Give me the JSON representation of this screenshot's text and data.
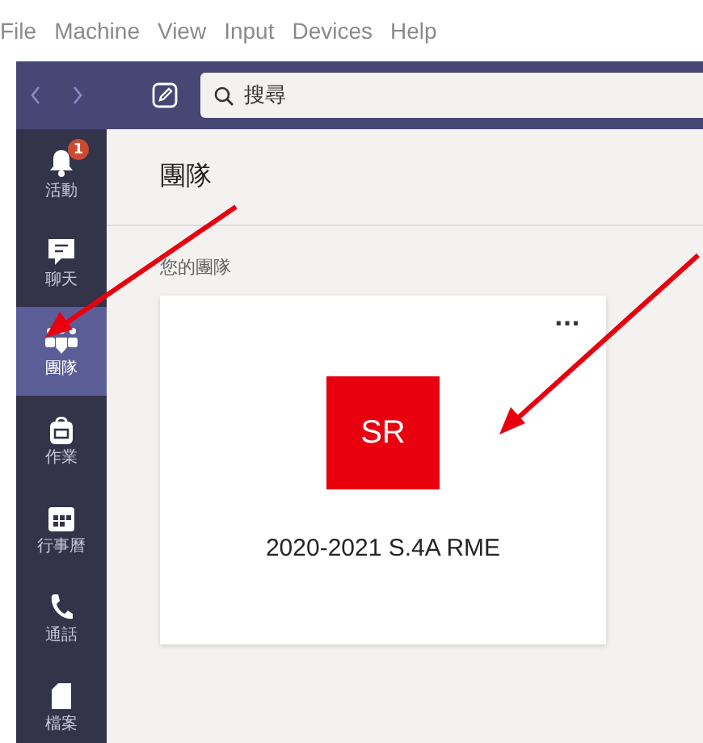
{
  "menu_bar": [
    "File",
    "Machine",
    "View",
    "Input",
    "Devices",
    "Help"
  ],
  "search": {
    "placeholder": "搜尋"
  },
  "sidebar": {
    "items": [
      {
        "kind": "bell",
        "label": "活動",
        "badge": "1",
        "selected": false
      },
      {
        "kind": "chat",
        "label": "聊天",
        "selected": false
      },
      {
        "kind": "teams",
        "label": "團隊",
        "selected": true
      },
      {
        "kind": "bag",
        "label": "作業",
        "selected": false
      },
      {
        "kind": "calendar",
        "label": "行事曆",
        "selected": false
      },
      {
        "kind": "phone",
        "label": "通話",
        "selected": false
      },
      {
        "kind": "file",
        "label": "檔案",
        "selected": false
      }
    ]
  },
  "page": {
    "title": "團隊",
    "section": "您的團隊",
    "teams": [
      {
        "initials": "SR",
        "name": "2020-2021 S.4A RME",
        "color": "#e8000f",
        "more": "···"
      }
    ]
  }
}
